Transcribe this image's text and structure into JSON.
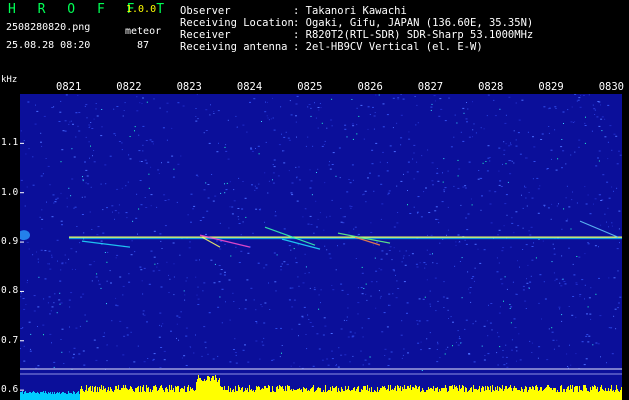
{
  "header": {
    "app_title": "H R O F F T",
    "app_version": "1.0.0",
    "file_name": "2508280820.png",
    "type_label": "meteor",
    "datetime": "25.08.28 08:20",
    "count": "87",
    "observer_label": "Observer",
    "observer_value": ": Takanori Kawachi",
    "location_label": "Receiving Location",
    "location_value": ": Ogaki, Gifu, JAPAN (136.60E, 35.35N)",
    "receiver_label": "Receiver",
    "receiver_value": ": R820T2(RTL-SDR) SDR-Sharp 53.1000MHz",
    "antenna_label": "Receiving antenna",
    "antenna_value": ": 2el-HB9CV Vertical (el. E-W)"
  },
  "colors": {
    "background": "#0b0f9a",
    "accent_green": "#00ff55",
    "accent_yellow": "#ffff00",
    "carrier_line": "#f0ff60",
    "noise_bar": "#ffff00"
  },
  "chart_data": {
    "type": "heatmap",
    "y_unit": "kHz",
    "x_ticks": [
      "0821",
      "0822",
      "0823",
      "0824",
      "0825",
      "0826",
      "0827",
      "0828",
      "0829",
      "0830"
    ],
    "y_ticks": [
      "1.1",
      "1.0",
      "0.9",
      "0.8",
      "0.7",
      "0.6"
    ],
    "y_range": [
      0.58,
      1.2
    ],
    "carrier_freq_khz": 0.91,
    "carrier_start_minute": "0821"
  }
}
